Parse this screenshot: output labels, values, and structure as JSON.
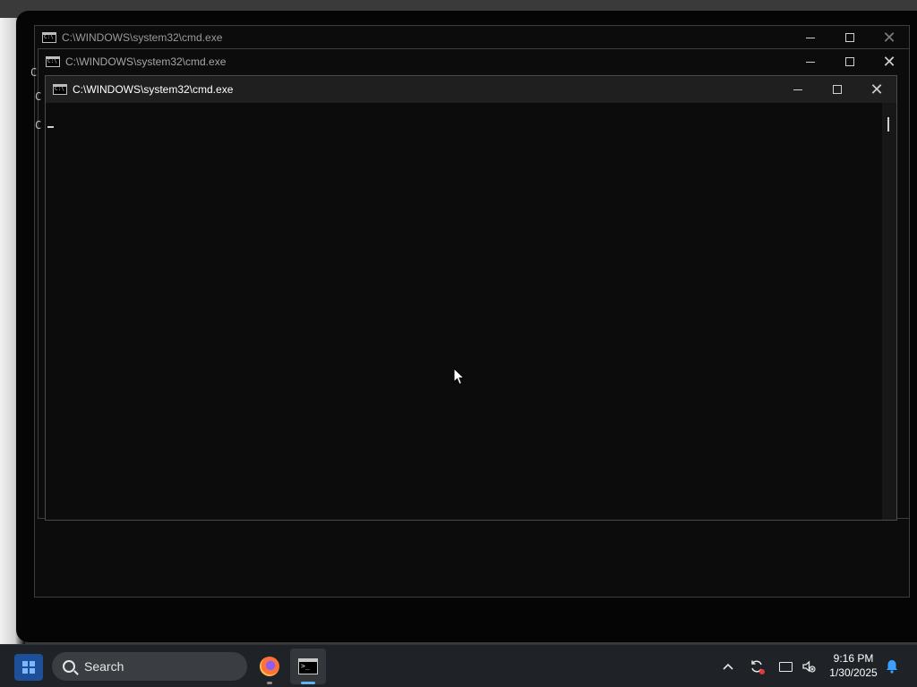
{
  "windows": [
    {
      "title": "C:\\WINDOWS\\system32\\cmd.exe",
      "state": "background"
    },
    {
      "title": "C:\\WINDOWS\\system32\\cmd.exe",
      "state": "background"
    },
    {
      "title": "C:\\WINDOWS\\system32\\cmd.exe",
      "state": "active"
    }
  ],
  "window_controls": {
    "minimize": "–",
    "maximize": "☐",
    "close": "✕"
  },
  "peek_chars": [
    "C",
    "C",
    "C"
  ],
  "taskbar": {
    "search_label": "Search",
    "apps": [
      {
        "name": "Firefox",
        "running": true
      },
      {
        "name": "Command Prompt",
        "running": true,
        "active": true
      }
    ],
    "tray": {
      "icons": [
        "chevron-up-icon",
        "sync-alert-icon",
        "network-icon",
        "volume-muted-icon"
      ],
      "time": "9:16 PM",
      "date": "1/30/2025",
      "notification_icon": "bell-icon"
    }
  },
  "colors": {
    "console_bg": "#0c0c0c",
    "taskbar_bg": "#1f2327",
    "accent": "#5fb2f2",
    "notification": "#3aa0ff"
  }
}
